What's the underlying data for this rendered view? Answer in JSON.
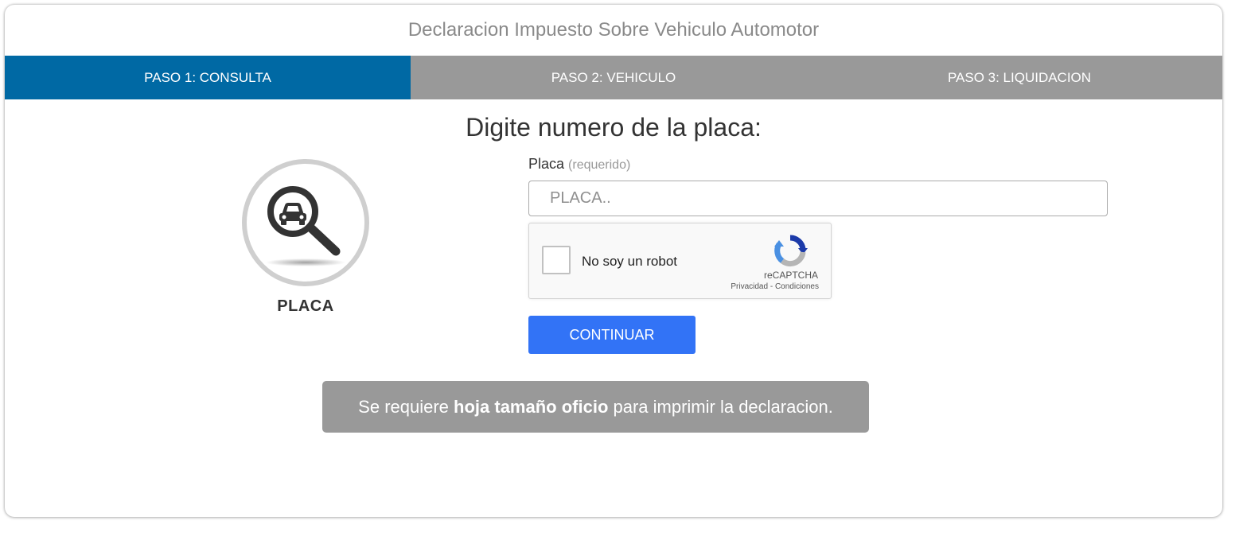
{
  "page": {
    "title": "Declaracion Impuesto Sobre Vehiculo Automotor"
  },
  "steps": [
    {
      "label": "PASO 1: CONSULTA",
      "active": true
    },
    {
      "label": "PASO 2: VEHICULO",
      "active": false
    },
    {
      "label": "PASO 3: LIQUIDACION",
      "active": false
    }
  ],
  "main": {
    "heading": "Digite numero de la placa:",
    "icon": {
      "name": "car-search-icon",
      "label": "PLACA"
    }
  },
  "form": {
    "plate": {
      "label": "Placa",
      "hint": "(requerido)",
      "placeholder": "PLACA..",
      "value": ""
    },
    "captcha": {
      "text": "No soy un robot",
      "brand": "reCAPTCHA",
      "privacy": "Privacidad",
      "separator": " - ",
      "terms": "Condiciones"
    },
    "submit_label": "CONTINUAR"
  },
  "notice": {
    "prefix": "Se requiere ",
    "bold": "hoja tamaño oficio",
    "suffix": " para imprimir la declaracion."
  },
  "colors": {
    "active_step": "#0069a4",
    "inactive_step": "#999999",
    "button": "#3273f6",
    "notice_bg": "#999999"
  }
}
